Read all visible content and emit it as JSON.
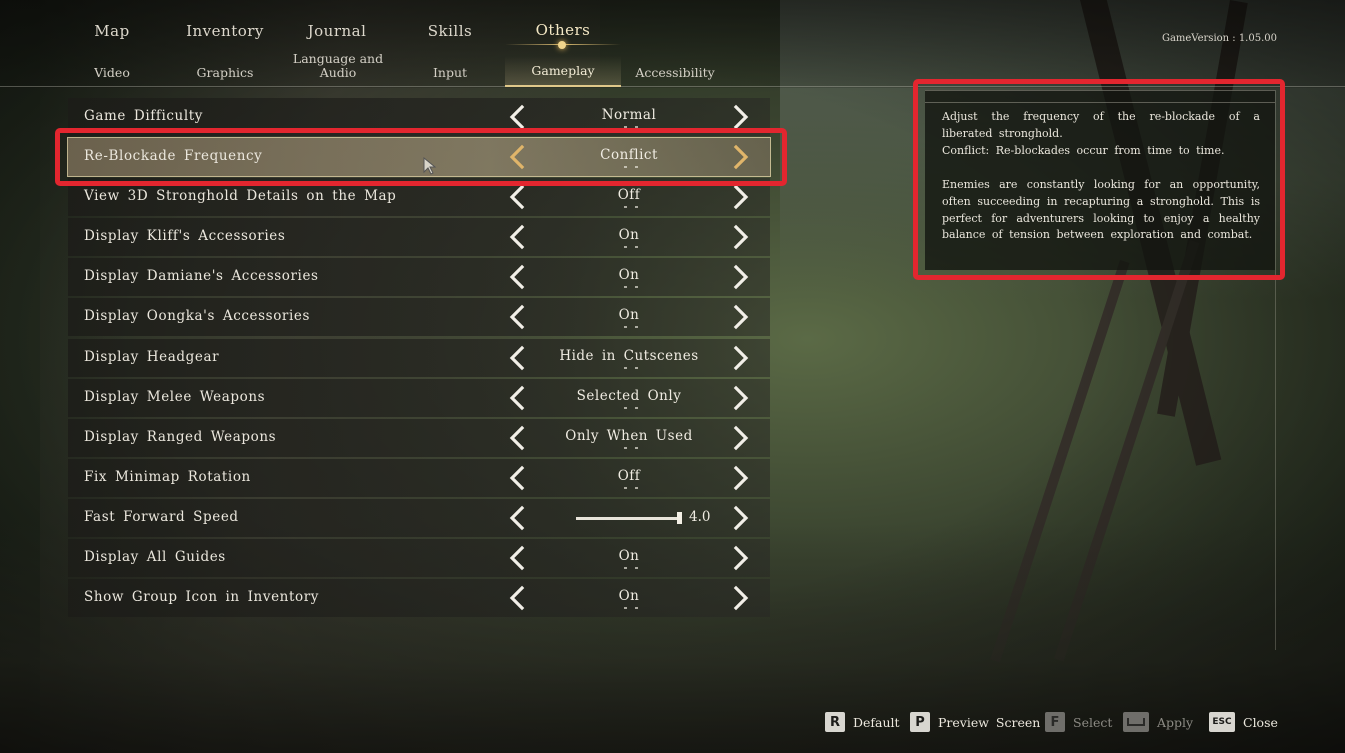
{
  "game_version": "GameVersion  :  1.05.00",
  "main_tabs": [
    {
      "label": "Map"
    },
    {
      "label": "Inventory"
    },
    {
      "label": "Journal"
    },
    {
      "label": "Skills"
    },
    {
      "label": "Others"
    }
  ],
  "sub_tabs": [
    {
      "label": "Video"
    },
    {
      "label": "Graphics"
    },
    {
      "label": "Language and Audio"
    },
    {
      "label": "Input"
    },
    {
      "label": "Gameplay"
    },
    {
      "label": "Accessibility"
    }
  ],
  "settings": [
    {
      "label": "Game Difficulty",
      "value": "Normal"
    },
    {
      "label": "Re-Blockade Frequency",
      "value": "Conflict"
    },
    {
      "label": "View 3D Stronghold Details on the Map",
      "value": "Off"
    },
    {
      "label": "Display Kliff's Accessories",
      "value": "On"
    },
    {
      "label": "Display Damiane's Accessories",
      "value": "On"
    },
    {
      "label": "Display Oongka's Accessories",
      "value": "On"
    },
    {
      "label": "Display Headgear",
      "value": "Hide in Cutscenes"
    },
    {
      "label": "Display Melee Weapons",
      "value": "Selected Only"
    },
    {
      "label": "Display Ranged Weapons",
      "value": "Only When Used"
    },
    {
      "label": "Fix Minimap Rotation",
      "value": "Off"
    },
    {
      "label": "Fast Forward Speed",
      "value": "4.0",
      "slider_fraction": 0.97
    },
    {
      "label": "Display All Guides",
      "value": "On"
    },
    {
      "label": "Show Group Icon in Inventory",
      "value": "On"
    }
  ],
  "description": {
    "para1": "Adjust the frequency of the re-blockade of a liberated stronghold.",
    "para2": "Conflict: Re-blockades occur from time to time.",
    "para3": "Enemies are constantly looking for an opportunity, often succeeding in recapturing a stronghold. This is perfect for adventurers looking to enjoy a healthy balance of tension between exploration and combat."
  },
  "footer": {
    "default": {
      "key": "R",
      "label": "Default"
    },
    "preview": {
      "key": "P",
      "label": "Preview Screen"
    },
    "select": {
      "key": "F",
      "label": "Select"
    },
    "apply": {
      "key": "space",
      "label": "Apply"
    },
    "close": {
      "key": "ESC",
      "label": "Close"
    }
  },
  "colors": {
    "highlight_red": "#e3262f",
    "accent_gold": "#d8b970",
    "selected_arrow": "#e0b56a"
  }
}
